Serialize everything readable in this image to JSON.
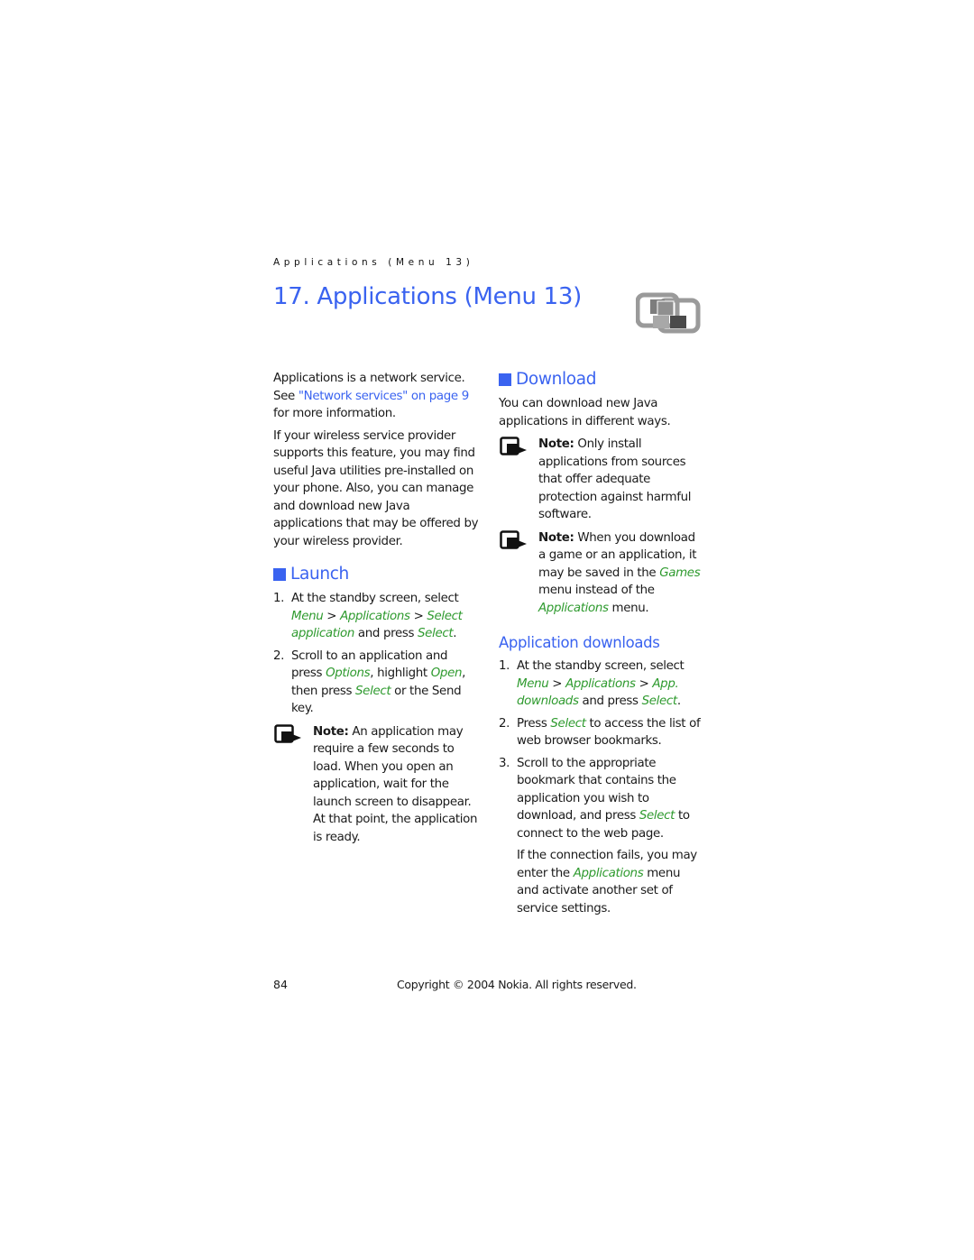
{
  "running_head": "Applications (Menu 13)",
  "chapter_title": "17. Applications (Menu 13)",
  "chapter_icon": "applications-menu-icon",
  "intro": {
    "p1_text1": "Applications is a network service. See ",
    "p1_link": "\"Network services\" on page 9",
    "p1_text2": " for more information.",
    "p2": "If your wireless service provider supports this feature, you may find useful Java utilities pre-installed on your phone. Also, you can manage and download new Java applications that may be offered by your wireless provider."
  },
  "launch": {
    "heading": "Launch",
    "steps": [
      {
        "num": "1.",
        "t1": "At the standby screen, select ",
        "u1": "Menu",
        "t2": " > ",
        "u2": "Applications",
        "t3": " > ",
        "u3": "Select application",
        "t4": " and press ",
        "u4": "Select",
        "t5": "."
      },
      {
        "num": "2.",
        "t1": "Scroll to an application and press ",
        "u1": "Options",
        "t2": ", highlight ",
        "u2": "Open",
        "t3": ", then press ",
        "u3": "Select",
        "t4": " or the ",
        "b1": "Send",
        "t5": " key."
      }
    ],
    "note_label": "Note:",
    "note_text": " An application may require a few seconds to load. When you open an application, wait for the launch screen to disappear. At that point, the application is ready."
  },
  "download": {
    "heading": "Download",
    "intro": "You can download new Java applications in different ways.",
    "note1_label": "Note:",
    "note1_text": " Only install applications from sources that offer adequate protection against harmful software.",
    "note2_label": "Note:",
    "note2_t1": " When you download a game or an application, it may be saved in the ",
    "note2_u1": "Games",
    "note2_t2": " menu instead of the ",
    "note2_u2": "Applications",
    "note2_t3": " menu."
  },
  "app_downloads": {
    "heading": "Application downloads",
    "steps": [
      {
        "num": "1.",
        "t1": "At the standby screen, select ",
        "u1": "Menu",
        "t2": " > ",
        "u2": "Applications",
        "t3": " > ",
        "u3": "App. downloads",
        "t4": " and press ",
        "u4": "Select",
        "t5": "."
      },
      {
        "num": "2.",
        "t1": "Press ",
        "u1": "Select",
        "t2": " to access the list of web browser bookmarks."
      },
      {
        "num": "3.",
        "t1": "Scroll to the appropriate bookmark that contains the application you wish to download, and press ",
        "u1": "Select",
        "t2": " to connect to the web page."
      }
    ],
    "after_t1": "If the connection fails, you may enter the ",
    "after_u1": "Applications",
    "after_t2": " menu and activate another set of service settings."
  },
  "footer": {
    "page_number": "84",
    "copyright": "Copyright © 2004 Nokia. All rights reserved."
  },
  "colors": {
    "heading_blue": "#3a63f0",
    "ui_green": "#2e9a2e"
  }
}
